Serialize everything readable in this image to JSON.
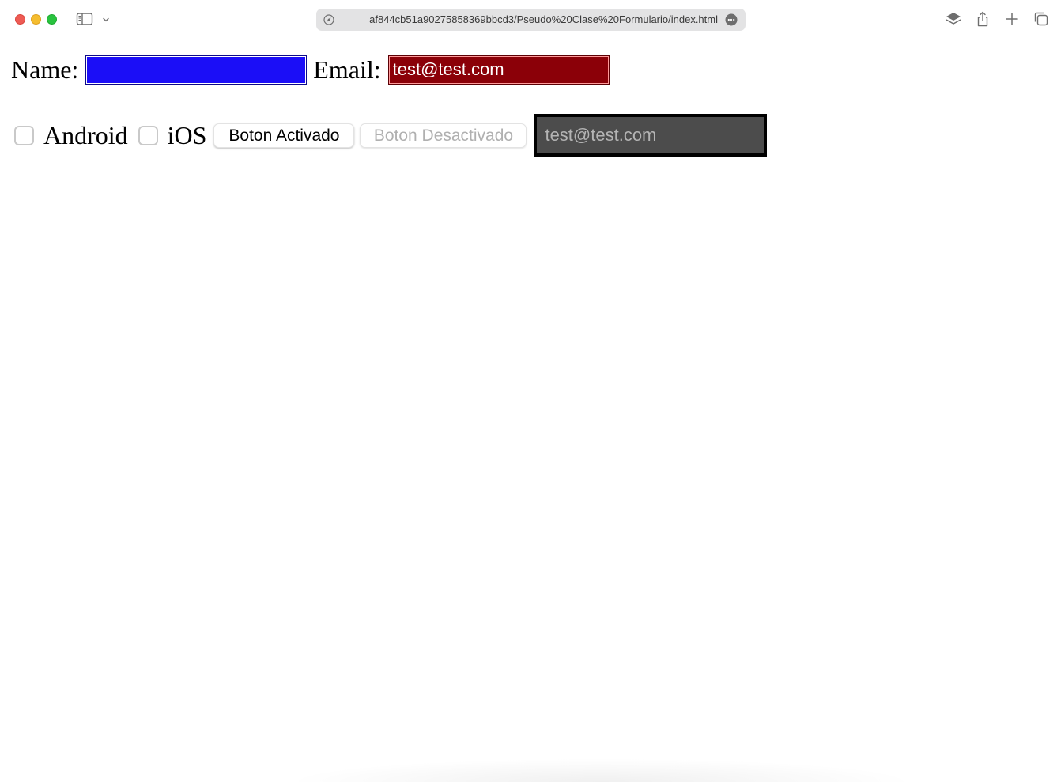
{
  "browser": {
    "url": "af844cb51a90275858369bbcd3/Pseudo%20Clase%20Formulario/index.html",
    "toolbar_icons": [
      "sidebar-icon",
      "chevron-down-icon",
      "compass-icon",
      "more-icon",
      "layers-icon",
      "share-icon",
      "plus-icon",
      "tabs-overview-icon"
    ]
  },
  "form": {
    "name_label": "Name:",
    "name_value": "",
    "email_label": "Email:",
    "email_value": "test@test.com",
    "checkbox_android_label": "Android",
    "checkbox_ios_label": "iOS",
    "checkbox_android_checked": false,
    "checkbox_ios_checked": false,
    "button_active_label": "Boton Activado",
    "button_disabled_label": "Boton Desactivado",
    "dark_input_value": "test@test.com"
  },
  "colors": {
    "name_input_bg": "#1b0ef7",
    "email_input_bg": "#8b0008",
    "dark_input_bg": "#4c4c4c"
  }
}
